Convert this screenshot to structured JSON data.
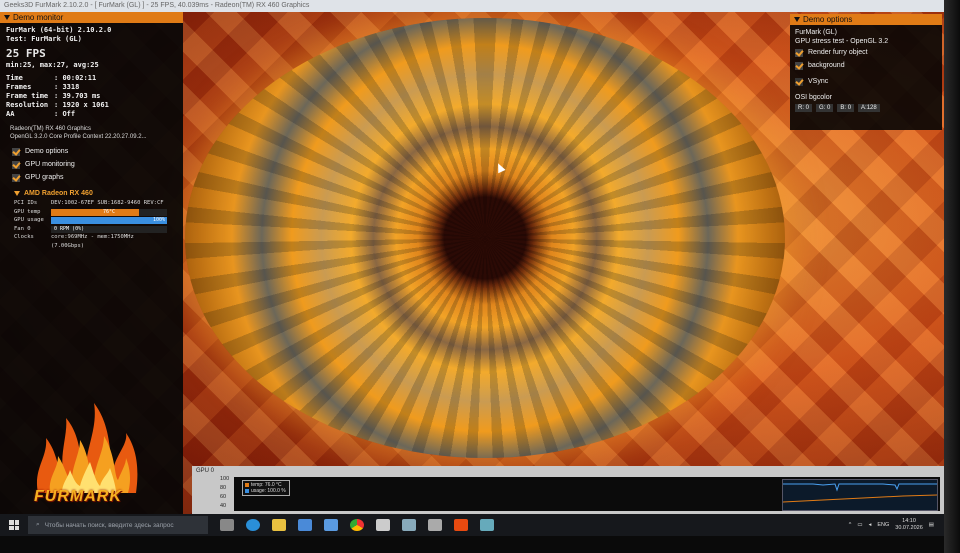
{
  "window": {
    "title": "Geeks3D FurMark 2.10.2.0 - [ FurMark (GL) ] - 25 FPS, 40.039ms - Radeon(TM) RX 460 Graphics"
  },
  "demo_monitor": {
    "header": "Demo monitor",
    "app_line": "FurMark (64-bit) 2.10.2.0",
    "test_line": "Test: FurMark (GL)",
    "fps": "25 FPS",
    "fps_stats": "min:25, max:27, avg:25",
    "stats": [
      {
        "label": "Time",
        "value": "00:02:11"
      },
      {
        "label": "Frames",
        "value": "3318"
      },
      {
        "label": "Frame time",
        "value": "39.703 ms"
      },
      {
        "label": "Resolution",
        "value": "1920 x 1061"
      },
      {
        "label": "AA",
        "value": "Off"
      }
    ],
    "gpu_name": "Radeon(TM) RX 460 Graphics",
    "gl_context": "OpenGL 3.2.0 Core Profile Context 22.20.27.09.2...",
    "options": [
      "Demo options",
      "GPU monitoring",
      "GPU graphs"
    ]
  },
  "gpu_section": {
    "title": "AMD Radeon RX 460",
    "pci_label": "PCI IDs",
    "pci_value": "DEV:1002-67EF SUB:1682-9460 REV:CF",
    "temp_label": "GPU temp",
    "temp_value": "76°C",
    "temp_fraction": 0.76,
    "usage_label": "GPU usage",
    "usage_value": "100%",
    "usage_fraction": 1.0,
    "fan_label": "Fan 0",
    "fan_value": "0 RPM (0%)",
    "clocks_label": "Clocks",
    "clocks_value": "core:969MHz - mem:1750MHz (7.00Gbps)"
  },
  "logo": {
    "text": "FURMARK"
  },
  "demo_options": {
    "header": "Demo options",
    "title": "FurMark (GL)",
    "subtitle": "GPU stress test - OpenGL 3.2",
    "checks": [
      "Render furry object",
      "background"
    ],
    "vsync": "VSync",
    "osi_label": "OSI bgcolor",
    "osi_values": [
      "R: 0",
      "G: 0",
      "B: 0",
      "A:128"
    ]
  },
  "graph": {
    "title": "GPU 0",
    "axis": [
      "100",
      "80",
      "60",
      "40"
    ],
    "legend_temp": "temp: 76.0 °C",
    "legend_usage": "usage: 100.0 %"
  },
  "taskbar": {
    "search_placeholder": "Чтобы начать поиск, введите здесь запрос",
    "lang": "ENG",
    "time": "14:10",
    "date": "30.07.2026"
  },
  "colors": {
    "accent": "#e07b16",
    "temp": "#f0a030",
    "usage": "#3a8fe0"
  }
}
